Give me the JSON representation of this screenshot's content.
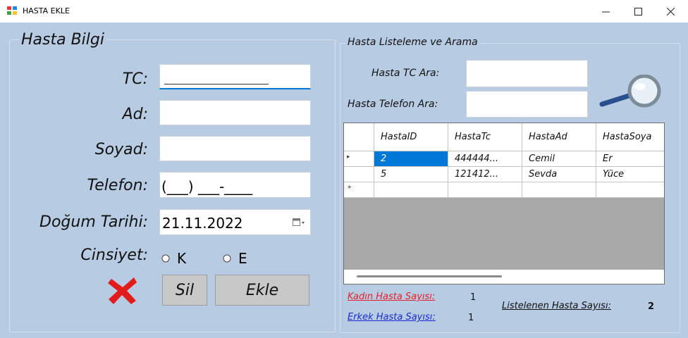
{
  "window": {
    "title": "HASTA EKLE",
    "minimize_glyph": "—",
    "maximize_glyph": "☐",
    "close_glyph": "✕"
  },
  "patient_info": {
    "group_title": "Hasta Bilgi",
    "tc_label": "TC:",
    "tc_value": "",
    "ad_label": "Ad:",
    "ad_value": "",
    "soyad_label": "Soyad:",
    "soyad_value": "",
    "telefon_label": "Telefon:",
    "telefon_mask": "(___) ___-____",
    "dogum_label": "Doğum Tarihi:",
    "dogum_value": "21.11.2022",
    "cinsiyet_label": "Cinsiyet:",
    "gender_options": [
      "K",
      "E"
    ],
    "delete_label": "Sil",
    "add_label": "Ekle"
  },
  "search": {
    "group_title": "Hasta Listeleme ve Arama",
    "tc_search_label": "Hasta TC Ara:",
    "tc_search_value": "",
    "phone_search_label": "Hasta Telefon Ara:",
    "phone_search_value": ""
  },
  "grid": {
    "columns": [
      "HastaID",
      "HastaTc",
      "HastaAd",
      "HastaSoya"
    ],
    "rows": [
      [
        "2",
        "444444...",
        "Cemil",
        "Er"
      ],
      [
        "5",
        "121412...",
        "Sevda",
        "Yüce"
      ]
    ],
    "new_row_marker": "*",
    "current_row_marker": "▸"
  },
  "stats": {
    "female_label": "Kadın Hasta Sayısı:",
    "female_count": "1",
    "male_label": "Erkek Hasta Sayısı:",
    "male_count": "1",
    "listed_label": "Listelenen Hasta Sayısı:",
    "listed_count": "2"
  },
  "colors": {
    "form_background": "#b7cbe2",
    "female_link": "#e8202a",
    "male_link": "#1b2ad0",
    "selection": "#0078d7"
  }
}
